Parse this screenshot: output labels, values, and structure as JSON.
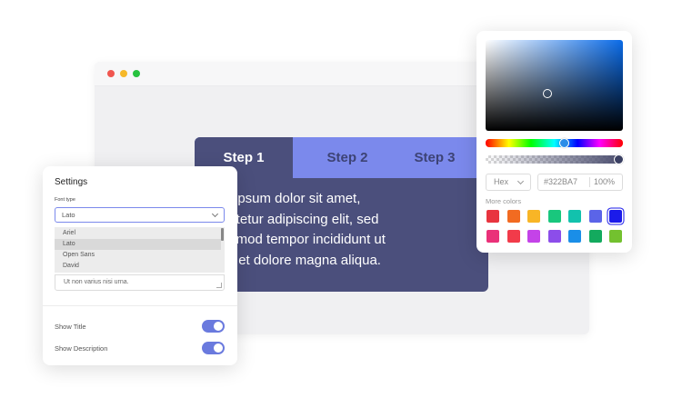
{
  "browser": {
    "window_controls": [
      "close",
      "minimize",
      "maximize"
    ]
  },
  "tabs": {
    "items": [
      {
        "label": "Step 1",
        "active": true
      },
      {
        "label": "Step 2",
        "active": false
      },
      {
        "label": "Step 3",
        "active": false
      }
    ],
    "content_lines": [
      "rem ipsum dolor sit amet,",
      "nsectetur adipiscing elit, sed",
      " eiusmod tempor incididunt ut",
      "bore et dolore magna aliqua."
    ]
  },
  "settings": {
    "title": "Settings",
    "font_type_label": "Font type",
    "font_selected": "Lato",
    "font_options": [
      "Ariel",
      "Lato",
      "Open Sans",
      "David"
    ],
    "description_text": "Ut non varius nisi urna.",
    "toggles": [
      {
        "label": "Show Title",
        "on": true
      },
      {
        "label": "Show Description",
        "on": true
      }
    ]
  },
  "color_picker": {
    "format": "Hex",
    "hex_value": "#322BA7",
    "alpha_value": "100%",
    "more_colors_label": "More colors",
    "swatches_row1": [
      "#e8343f",
      "#f26b21",
      "#f8b526",
      "#19c77d",
      "#12c2ad",
      "#5b64e8",
      "#1b1bea"
    ],
    "swatches_row2": [
      "#ea3179",
      "#f23b4a",
      "#c443e8",
      "#8c4dea",
      "#1a8ee8",
      "#13aa5e",
      "#73c12f"
    ],
    "active_swatch": "#1b1bea"
  },
  "colors": {
    "accent": "#7b89ec",
    "tab_panel": "#4b4f7c",
    "toggle_on": "#6a7ade"
  }
}
